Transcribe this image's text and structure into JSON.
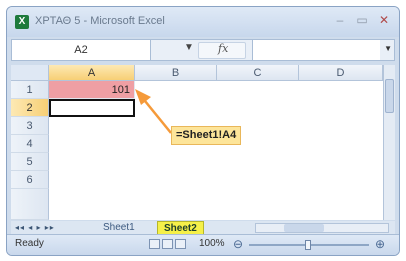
{
  "window": {
    "title": "ΧΡΤΑΘ 5 - Microsoft Excel",
    "controls": {
      "minimize": "–",
      "maximize": "▭",
      "close": "✕"
    }
  },
  "formula_bar": {
    "name_box": "A2",
    "name_dropdown": "▼",
    "fx": "fx",
    "formula": ""
  },
  "grid": {
    "columns": [
      "A",
      "B",
      "C",
      "D"
    ],
    "rows": [
      "1",
      "2",
      "3",
      "4",
      "5",
      "6"
    ],
    "active_column": "A",
    "active_row": "2",
    "cells": {
      "A1": "101",
      "A2": ""
    }
  },
  "annotation": {
    "callout_text": "=Sheet1!A4",
    "accent": "#f59a3a"
  },
  "sheet_tabs": {
    "nav": "◂◂ ◂ ▸ ▸▸",
    "tabs": [
      "Sheet1",
      "Sheet2"
    ],
    "active": "Sheet2"
  },
  "status_bar": {
    "status": "Ready",
    "zoom": "100%",
    "zoom_minus": "⊖",
    "zoom_plus": "⊕"
  },
  "colors": {
    "cell_a1_fill": "#ef9fa4",
    "active_tab": "#f5f049",
    "callout_fill": "#fde59a"
  }
}
